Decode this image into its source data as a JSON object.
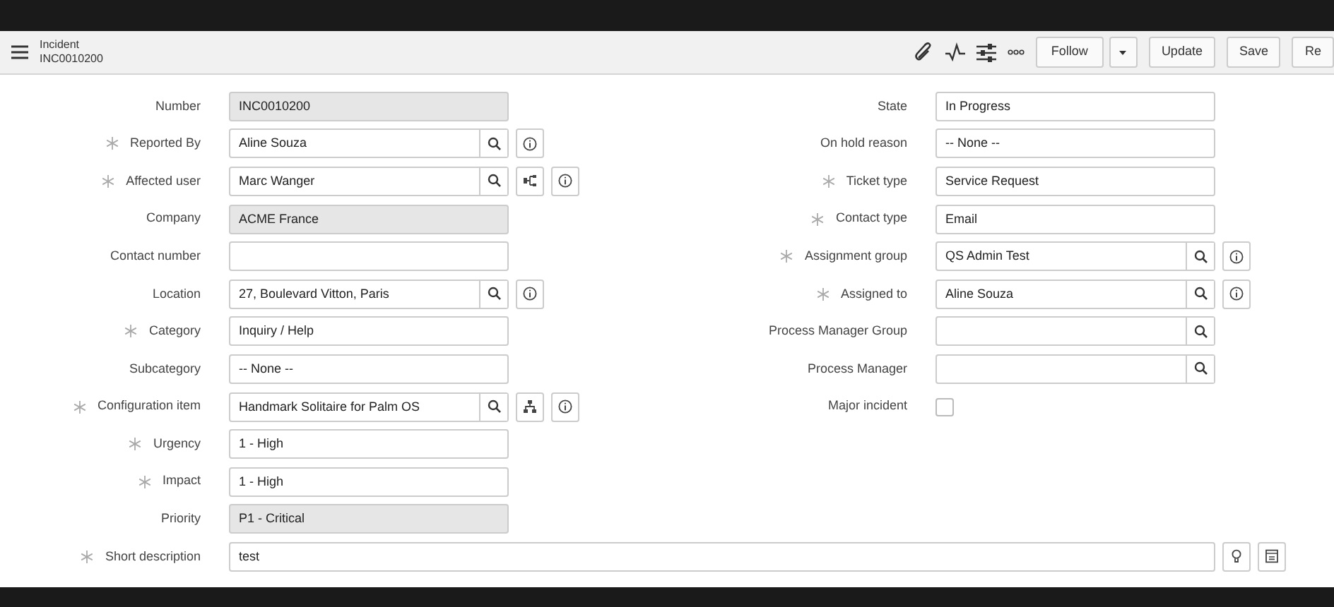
{
  "header": {
    "title": "Incident",
    "number": "INC0010200",
    "buttons": [
      {
        "label": "Follow",
        "kind": "split"
      },
      {
        "label": "Update",
        "kind": "plain"
      },
      {
        "label": "Save",
        "kind": "plain"
      },
      {
        "label": "Re",
        "kind": "plain"
      }
    ]
  },
  "form": {
    "left": [
      {
        "label": "Number",
        "required": false,
        "value": "INC0010200",
        "readonly": true,
        "lookup": false
      },
      {
        "label": "Reported By",
        "required": true,
        "value": "Aline Souza",
        "readonly": false,
        "lookup": true,
        "actions": [
          {
            "kind": "info"
          }
        ]
      },
      {
        "label": "Affected user",
        "required": true,
        "value": "Marc Wanger",
        "readonly": false,
        "lookup": true,
        "actions": [
          {
            "kind": "tree"
          },
          {
            "kind": "info"
          }
        ]
      },
      {
        "label": "Company",
        "required": false,
        "value": "ACME France",
        "readonly": true,
        "lookup": false
      },
      {
        "label": "Contact number",
        "required": false,
        "readonly": false,
        "lookup": false
      },
      {
        "label": "Location",
        "required": false,
        "value": "27, Boulevard Vitton, Paris",
        "readonly": false,
        "lookup": true,
        "actions": [
          {
            "kind": "info"
          }
        ]
      },
      {
        "label": "Category",
        "required": true,
        "value": "Inquiry / Help",
        "readonly": false,
        "lookup": false
      },
      {
        "label": "Subcategory",
        "required": false,
        "value": "-- None --",
        "readonly": false,
        "lookup": false
      },
      {
        "label": "Configuration item",
        "required": true,
        "value": "Handmark Solitaire for Palm OS",
        "readonly": false,
        "lookup": true,
        "actions": [
          {
            "kind": "hierarchy"
          },
          {
            "kind": "info"
          }
        ]
      },
      {
        "label": "Urgency",
        "required": true,
        "value": "1 - High",
        "readonly": false,
        "lookup": false
      },
      {
        "label": "Impact",
        "required": true,
        "value": "1 - High",
        "readonly": false,
        "lookup": false
      },
      {
        "label": "Priority",
        "required": false,
        "value": "P1 - Critical",
        "readonly": true,
        "lookup": false
      }
    ],
    "right": [
      {
        "label": "State",
        "required": false,
        "value": "In Progress",
        "readonly": false,
        "lookup": false
      },
      {
        "label": "On hold reason",
        "required": false,
        "value": "-- None --",
        "readonly": false,
        "lookup": false
      },
      {
        "label": "Ticket type",
        "required": true,
        "value": "Service Request",
        "readonly": false,
        "lookup": false
      },
      {
        "label": "Contact type",
        "required": true,
        "value": "Email",
        "readonly": false,
        "lookup": false
      },
      {
        "label": "Assignment group",
        "required": true,
        "value": "QS Admin Test",
        "readonly": false,
        "lookup": true,
        "actions": [
          {
            "kind": "info"
          }
        ]
      },
      {
        "label": "Assigned to",
        "required": true,
        "value": "Aline Souza",
        "readonly": false,
        "lookup": true,
        "actions": [
          {
            "kind": "info"
          }
        ]
      },
      {
        "label": "Process Manager Group",
        "required": false,
        "readonly": false,
        "lookup": true
      },
      {
        "label": "Process Manager",
        "required": false,
        "readonly": false,
        "lookup": true
      },
      {
        "label": "Major incident",
        "required": false,
        "kind": "checkbox",
        "checked": false
      }
    ],
    "wide": [
      {
        "label": "Short description",
        "required": true,
        "value": "test",
        "readonly": false,
        "lookup": false,
        "actions": [
          {
            "kind": "suggest"
          },
          {
            "kind": "template"
          }
        ]
      }
    ]
  }
}
